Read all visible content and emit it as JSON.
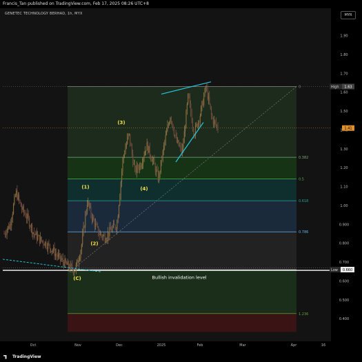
{
  "header": {
    "publisher_line": "Francis_Tan published on TradingView.com, Feb 17, 2025 08:26 UTC+8"
  },
  "footer": {
    "brand": "TradingView"
  },
  "chart_data": {
    "type": "candlestick",
    "symbol_title": "GENETEC TECHNOLOGY BERHAD, 1h, MYX",
    "currency": "MYR",
    "ylim": [
      0.33,
      2.0
    ],
    "y_ticks": [
      "1.90",
      "1.80",
      "1.70",
      "1.60",
      "1.50",
      "1.40",
      "1.30",
      "1.20",
      "1.10",
      "1.00",
      "0.900",
      "0.800",
      "0.700",
      "0.600",
      "0.500",
      "0.400"
    ],
    "x_ticks": [
      "Oct",
      "Nov",
      "Dec",
      "2025",
      "Feb",
      "Mar",
      "Apr",
      "16"
    ],
    "price_labels": {
      "high_label": "High",
      "high_value": "1.63",
      "last_value": "1.41",
      "low_label": "Low",
      "low_value": "0.660"
    },
    "fib_levels": [
      {
        "ratio": "0",
        "price": 1.63,
        "label": "0"
      },
      {
        "ratio": "0.382",
        "price": 1.255,
        "label": "0.382"
      },
      {
        "ratio": "0.5",
        "price": 1.14,
        "label": "0.5"
      },
      {
        "ratio": "0.618",
        "price": 1.025,
        "label": "0.618"
      },
      {
        "ratio": "0.786",
        "price": 0.86,
        "label": "0.786"
      },
      {
        "ratio": "1",
        "price": 0.66,
        "label": ""
      },
      {
        "ratio": "1.236",
        "price": 0.427,
        "label": "1.236"
      }
    ],
    "wave_labels": [
      "(1)",
      "(2)",
      "(3)",
      "(4)",
      "(C)"
    ],
    "annotation": "Bullish invalidation level",
    "key_prices": [
      0.85,
      0.9,
      1.07,
      0.98,
      0.93,
      0.85,
      0.82,
      0.8,
      0.77,
      0.73,
      0.7,
      0.67,
      0.66,
      0.78,
      1.02,
      0.92,
      0.85,
      0.83,
      0.87,
      0.9,
      1.25,
      1.38,
      1.18,
      1.22,
      1.32,
      1.24,
      1.14,
      1.33,
      1.48,
      1.34,
      1.28,
      1.58,
      1.38,
      1.48,
      1.63,
      1.46,
      1.41
    ]
  }
}
